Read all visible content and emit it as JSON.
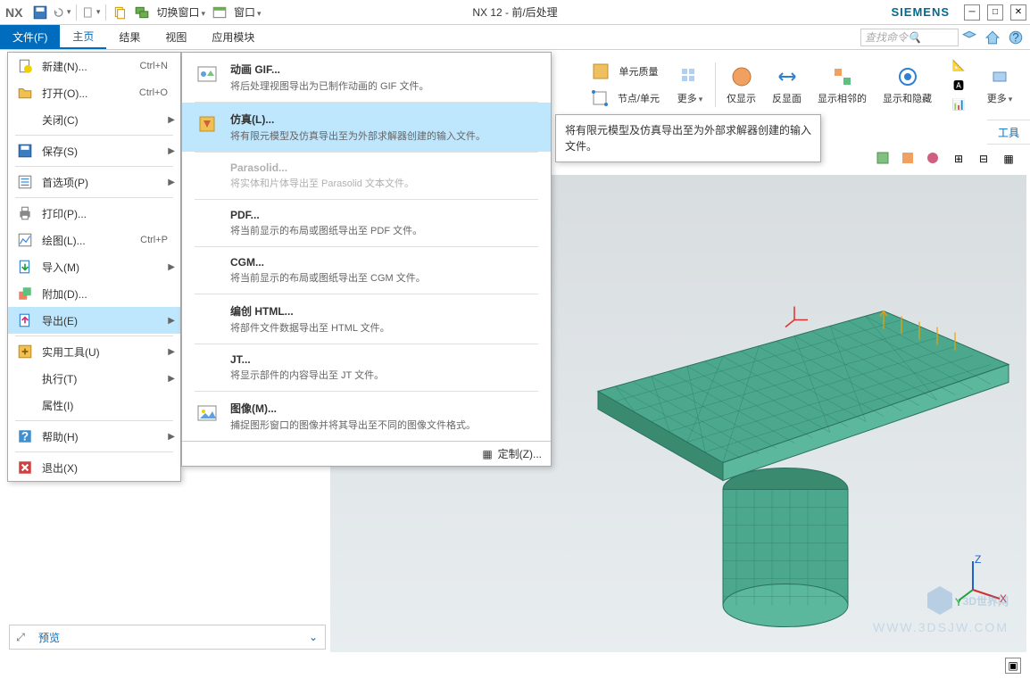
{
  "title": "NX 12 - 前/后处理",
  "brand": "SIEMENS",
  "logo": "NX",
  "quickAccess": {
    "switchWindow": "切换窗口",
    "window": "窗口"
  },
  "searchPlaceholder": "查找命令",
  "menuTabs": {
    "file": "文件(F)",
    "home": "主页",
    "results": "结果",
    "view": "视图",
    "app": "应用模块"
  },
  "fileMenu": [
    {
      "id": "new",
      "label": "新建(N)...",
      "shortcut": "Ctrl+N",
      "icon": "new"
    },
    {
      "id": "open",
      "label": "打开(O)...",
      "shortcut": "Ctrl+O",
      "icon": "open"
    },
    {
      "id": "close",
      "label": "关闭(C)",
      "arrow": true
    },
    {
      "sep": true
    },
    {
      "id": "save",
      "label": "保存(S)",
      "icon": "save",
      "arrow": true
    },
    {
      "sep": true
    },
    {
      "id": "prefs",
      "label": "首选项(P)",
      "icon": "prefs",
      "arrow": true
    },
    {
      "sep": true
    },
    {
      "id": "print",
      "label": "打印(P)...",
      "icon": "print"
    },
    {
      "id": "plot",
      "label": "绘图(L)...",
      "shortcut": "Ctrl+P",
      "icon": "plot"
    },
    {
      "id": "import",
      "label": "导入(M)",
      "icon": "import",
      "arrow": true
    },
    {
      "id": "addon",
      "label": "附加(D)...",
      "icon": "addon"
    },
    {
      "id": "export",
      "label": "导出(E)",
      "icon": "export",
      "arrow": true,
      "highlighted": true
    },
    {
      "sep": true
    },
    {
      "id": "utils",
      "label": "实用工具(U)",
      "icon": "utils",
      "arrow": true
    },
    {
      "id": "exec",
      "label": "执行(T)",
      "arrow": true
    },
    {
      "id": "props",
      "label": "属性(I)"
    },
    {
      "sep": true
    },
    {
      "id": "help",
      "label": "帮助(H)",
      "icon": "help",
      "arrow": true
    },
    {
      "sep": true
    },
    {
      "id": "exit",
      "label": "退出(X)",
      "icon": "exit"
    }
  ],
  "exportMenu": [
    {
      "id": "gif",
      "title": "动画 GIF...",
      "desc": "将后处理视图导出为已制作动画的 GIF 文件。",
      "icon": "gif-icon"
    },
    {
      "sep": true
    },
    {
      "id": "sim",
      "title": "仿真(L)...",
      "desc": "将有限元模型及仿真导出至为外部求解器创建的输入文件。",
      "icon": "sim-icon",
      "highlighted": true
    },
    {
      "sep": true
    },
    {
      "id": "parasolid",
      "title": "Parasolid...",
      "desc": "将实体和片体导出至 Parasolid 文本文件。",
      "disabled": true
    },
    {
      "sep": true
    },
    {
      "id": "pdf",
      "title": "PDF...",
      "desc": "将当前显示的布局或图纸导出至 PDF 文件。"
    },
    {
      "sep": true
    },
    {
      "id": "cgm",
      "title": "CGM...",
      "desc": "将当前显示的布局或图纸导出至 CGM 文件。"
    },
    {
      "sep": true
    },
    {
      "id": "html",
      "title": "编创 HTML...",
      "desc": "将部件文件数据导出至 HTML 文件。"
    },
    {
      "sep": true
    },
    {
      "id": "jt",
      "title": "JT...",
      "desc": "将显示部件的内容导出至 JT 文件。"
    },
    {
      "sep": true
    },
    {
      "id": "image",
      "title": "图像(M)...",
      "desc": "捕捉图形窗口的图像并将其导出至不同的图像文件格式。",
      "icon": "image-icon"
    }
  ],
  "exportFooter": "定制(Z)...",
  "tooltip": "将有限元模型及仿真导出至为外部求解器创建的输入文件。",
  "ribbon": {
    "elemQuality": "单元质量",
    "nodeElem": "节点/单元",
    "more1": "更多",
    "showOnly": "仅显示",
    "reverse": "反显面",
    "showAdj": "显示相邻的",
    "showHide": "显示和隐藏",
    "more2": "更多"
  },
  "subToolbar": {
    "tools": "工具"
  },
  "navPanel": {
    "preview": "预览"
  },
  "watermark": {
    "main": "3D世界网",
    "sub": "WWW.3DSJW.COM"
  }
}
